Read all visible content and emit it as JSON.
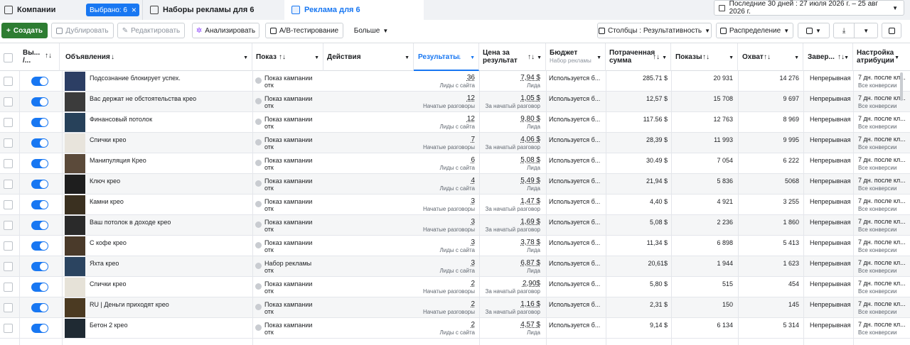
{
  "tabs": {
    "campaigns": "Компании",
    "selected_chip": "Выбрано: 6",
    "adsets": "Наборы рекламы для 6",
    "ads": "Реклама для 6"
  },
  "date_range": "Последние 30 дней : 27 июля 2026 г. – 25 авг 2026 г.",
  "toolbar": {
    "create": "Создать",
    "duplicate": "Дублировать",
    "edit": "Редактировать",
    "analyze": "Анализировать",
    "ab_test": "A/B-тестирование",
    "more": "Больше",
    "columns": "Столбцы : Результативность",
    "breakdown": "Распределение"
  },
  "headers": {
    "onoff": "Вы... /...",
    "ads": "Объявления",
    "delivery": "Показ",
    "actions": "Действия",
    "results": "Результаты",
    "cost": "Цена за результат",
    "budget": "Бюджет",
    "budget_sub": "Набор рекламы",
    "spent": "Потраченная сумма",
    "impressions": "Показы",
    "reach": "Охват",
    "ends": "Завер...",
    "attribution": "Настройка атрибуции"
  },
  "rows": [
    {
      "name": "Подсознание блокирует успех.",
      "delivery": "Показ кампании отк",
      "results": "36",
      "results_type": "Лиды с сайта",
      "cost": "7,94 $",
      "cost_type": "Лида",
      "budget": "Используется б...",
      "spent": "285.71 $",
      "impressions": "20 931",
      "reach": "14 276",
      "ends": "Непрерывная",
      "attr": "7 дн. после кл...",
      "attr_sub": "Все конверсии"
    },
    {
      "name": "Вас держат не обстоятельства крео",
      "delivery": "Показ кампании отк",
      "results": "12",
      "results_type": "Начатые разговоры",
      "cost": "1,05 $",
      "cost_type": "За начатый разговор",
      "budget": "Используется б...",
      "spent": "12,57 $",
      "impressions": "15 708",
      "reach": "9 697",
      "ends": "Непрерывная",
      "attr": "7 дн. после кл...",
      "attr_sub": "Все конверсии"
    },
    {
      "name": "Финансовый потолок",
      "delivery": "Показ кампании отк",
      "results": "12",
      "results_type": "Лиды с сайта",
      "cost": "9,80 $",
      "cost_type": "Лида",
      "budget": "Используется б...",
      "spent": "117.56 $",
      "impressions": "12 763",
      "reach": "8 969",
      "ends": "Непрерывная",
      "attr": "7 дн. после кл...",
      "attr_sub": "Все конверсии"
    },
    {
      "name": "Спички крео",
      "delivery": "Показ кампании отк",
      "results": "7",
      "results_type": "Начатые разговоры",
      "cost": "4,06 $",
      "cost_type": "За начатый разговор",
      "budget": "Используется б...",
      "spent": "28,39 $",
      "impressions": "11 993",
      "reach": "9 995",
      "ends": "Непрерывная",
      "attr": "7 дн. после кл...",
      "attr_sub": "Все конверсии"
    },
    {
      "name": "Манипуляция Крео",
      "delivery": "Показ кампании отк",
      "results": "6",
      "results_type": "Лиды с сайта",
      "cost": "5,08 $",
      "cost_type": "Лида",
      "budget": "Используется б...",
      "spent": "30.49 $",
      "impressions": "7 054",
      "reach": "6 222",
      "ends": "Непрерывная",
      "attr": "7 дн. после кл...",
      "attr_sub": "Все конверсии"
    },
    {
      "name": "Ключ крео",
      "delivery": "Показ кампании отк",
      "results": "4",
      "results_type": "Лиды с сайта",
      "cost": "5,49 $",
      "cost_type": "Лида",
      "budget": "Используется б...",
      "spent": "21,94 $",
      "impressions": "5 836",
      "reach": "5068",
      "ends": "Непрерывная",
      "attr": "7 дн. после кл...",
      "attr_sub": "Все конверсии"
    },
    {
      "name": "Камни крео",
      "delivery": "Показ кампании отк",
      "results": "3",
      "results_type": "Начатые разговоры",
      "cost": "1,47 $",
      "cost_type": "За начатый разговор",
      "budget": "Используется б...",
      "spent": "4,40 $",
      "impressions": "4 921",
      "reach": "3 255",
      "ends": "Непрерывная",
      "attr": "7 дн. после кл...",
      "attr_sub": "Все конверсии"
    },
    {
      "name": "Ваш потолок в доходе крео",
      "delivery": "Показ кампании отк",
      "results": "3",
      "results_type": "Начатые разговоры",
      "cost": "1,69 $",
      "cost_type": "За начатый разговор",
      "budget": "Используется б...",
      "spent": "5,08 $",
      "impressions": "2 236",
      "reach": "1 860",
      "ends": "Непрерывная",
      "attr": "7 дн. после кл...",
      "attr_sub": "Все конверсии"
    },
    {
      "name": "С кофе крео",
      "delivery": "Показ кампании отк",
      "results": "3",
      "results_type": "Лиды с сайта",
      "cost": "3,78 $",
      "cost_type": "Лида",
      "budget": "Используется б...",
      "spent": "11,34 $",
      "impressions": "6 898",
      "reach": "5 413",
      "ends": "Непрерывная",
      "attr": "7 дн. после кл...",
      "attr_sub": "Все конверсии"
    },
    {
      "name": "Яхта крео",
      "delivery": "Набор рекламы отк",
      "results": "3",
      "results_type": "Лиды с сайта",
      "cost": "6,87 $",
      "cost_type": "Лида",
      "budget": "Используется б...",
      "spent": "20,61$",
      "impressions": "1 944",
      "reach": "1 623",
      "ends": "Непрерывная",
      "attr": "7 дн. после кл...",
      "attr_sub": "Все конверсии"
    },
    {
      "name": "Спички крео",
      "delivery": "Показ кампании отк",
      "results": "2",
      "results_type": "Начатые разговоры",
      "cost": "2,90$",
      "cost_type": "За начатый разговор",
      "budget": "Используется б...",
      "spent": "5,80 $",
      "impressions": "515",
      "reach": "454",
      "ends": "Непрерывная",
      "attr": "7 дн. после кл...",
      "attr_sub": "Все конверсии"
    },
    {
      "name": "RU | Деньги приходят крео",
      "delivery": "Показ кампании отк",
      "results": "2",
      "results_type": "Начатые разговоры",
      "cost": "1,16 $",
      "cost_type": "За начатый разговор",
      "budget": "Используется б...",
      "spent": "2,31 $",
      "impressions": "150",
      "reach": "145",
      "ends": "Непрерывная",
      "attr": "7 дн. после кл...",
      "attr_sub": "Все конверсии"
    },
    {
      "name": "Бетон 2 крео",
      "delivery": "Показ кампании отк",
      "results": "2",
      "results_type": "Лиды с сайта",
      "cost": "4,57 $",
      "cost_type": "Лида",
      "budget": "Используется б...",
      "spent": "9,14 $",
      "impressions": "6 134",
      "reach": "5 314",
      "ends": "Непрерывная",
      "attr": "7 дн. после кл...",
      "attr_sub": "Все конверсии"
    }
  ]
}
